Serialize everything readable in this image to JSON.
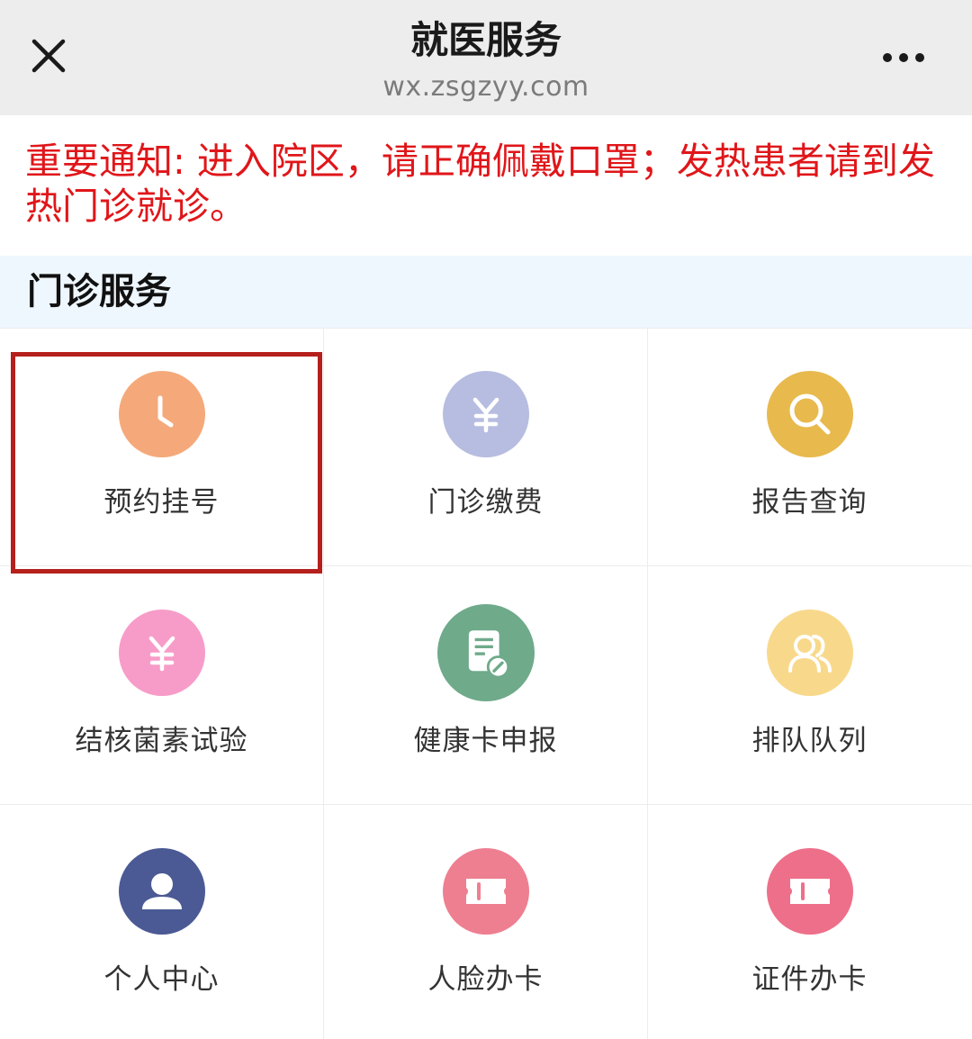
{
  "header": {
    "title": "就医服务",
    "url": "wx.zsgzyy.com",
    "close_icon": "close-icon",
    "more_icon": "more-icon"
  },
  "notice": {
    "text": "重要通知: 进入院区，请正确佩戴口罩；发热患者请到发热门诊就诊。",
    "color": "#e0161a"
  },
  "section": {
    "title": "门诊服务"
  },
  "services": [
    {
      "label": "预约挂号",
      "icon": "clock-icon",
      "color": "#f5a97a",
      "highlighted": true
    },
    {
      "label": "门诊缴费",
      "icon": "yen-icon",
      "color": "#b7bde0"
    },
    {
      "label": "报告查询",
      "icon": "search-icon",
      "color": "#e8b94d"
    },
    {
      "label": "结核菌素试验",
      "icon": "yen-icon",
      "color": "#f79cc8"
    },
    {
      "label": "健康卡申报",
      "icon": "document-edit-icon",
      "color": "#6faa8a"
    },
    {
      "label": "排队队列",
      "icon": "users-icon",
      "color": "#f8d98c"
    },
    {
      "label": "个人中心",
      "icon": "user-icon",
      "color": "#4b5a94"
    },
    {
      "label": "人脸办卡",
      "icon": "ticket-icon",
      "color": "#ee7f91"
    },
    {
      "label": "证件办卡",
      "icon": "ticket-icon",
      "color": "#ee6f8a"
    }
  ],
  "highlight_color": "#b5201c"
}
